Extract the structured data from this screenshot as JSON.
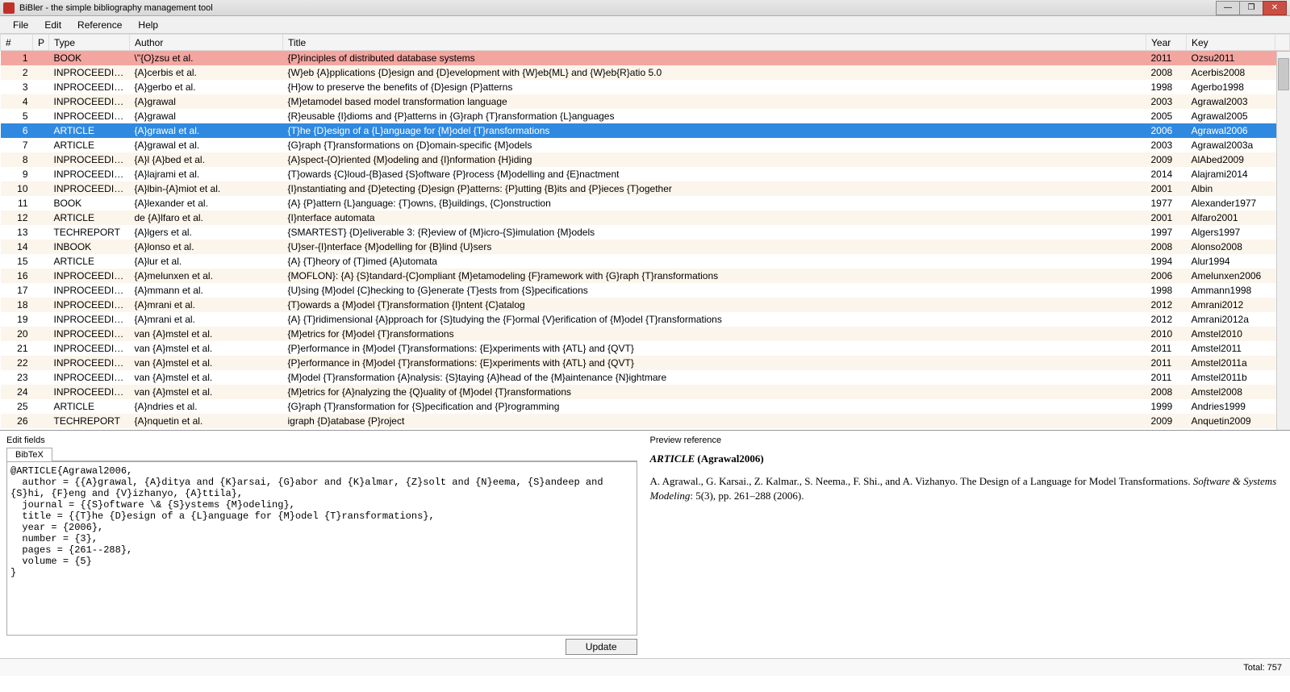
{
  "window": {
    "title": "BiBler - the simple bibliography management tool"
  },
  "menu": {
    "file": "File",
    "edit": "Edit",
    "reference": "Reference",
    "help": "Help"
  },
  "columns": {
    "num": "#",
    "p": "P",
    "type": "Type",
    "author": "Author",
    "title": "Title",
    "year": "Year",
    "key": "Key"
  },
  "rows": [
    {
      "n": "1",
      "type": "BOOK",
      "author": "\\\"{O}zsu et al.",
      "title": "{P}rinciples of distributed database systems",
      "year": "2011",
      "key": "Ozsu2011",
      "err": true
    },
    {
      "n": "2",
      "type": "INPROCEEDIN...",
      "author": "{A}cerbis et al.",
      "title": "{W}eb {A}pplications {D}esign and {D}evelopment with {W}eb{ML} and {W}eb{R}atio 5.0",
      "year": "2008",
      "key": "Acerbis2008"
    },
    {
      "n": "3",
      "type": "INPROCEEDIN...",
      "author": "{A}gerbo et al.",
      "title": "{H}ow to preserve the benefits of {D}esign {P}atterns",
      "year": "1998",
      "key": "Agerbo1998"
    },
    {
      "n": "4",
      "type": "INPROCEEDIN...",
      "author": "{A}grawal",
      "title": "{M}etamodel based model transformation language",
      "year": "2003",
      "key": "Agrawal2003"
    },
    {
      "n": "5",
      "type": "INPROCEEDIN...",
      "author": "{A}grawal",
      "title": "{R}eusable {I}dioms and {P}atterns in {G}raph {T}ransformation {L}anguages",
      "year": "2005",
      "key": "Agrawal2005"
    },
    {
      "n": "6",
      "type": "ARTICLE",
      "author": "{A}grawal et al.",
      "title": "{T}he {D}esign of a {L}anguage for {M}odel {T}ransformations",
      "year": "2006",
      "key": "Agrawal2006",
      "sel": true
    },
    {
      "n": "7",
      "type": "ARTICLE",
      "author": "{A}grawal et al.",
      "title": "{G}raph {T}ransformations on {D}omain-specific {M}odels",
      "year": "2003",
      "key": "Agrawal2003a"
    },
    {
      "n": "8",
      "type": "INPROCEEDIN...",
      "author": "{A}l {A}bed et al.",
      "title": "{A}spect-{O}riented {M}odeling and {I}nformation {H}iding",
      "year": "2009",
      "key": "AlAbed2009"
    },
    {
      "n": "9",
      "type": "INPROCEEDIN...",
      "author": "{A}lajrami et al.",
      "title": "{T}owards {C}loud-{B}ased {S}oftware {P}rocess {M}odelling and {E}nactment",
      "year": "2014",
      "key": "Alajrami2014"
    },
    {
      "n": "10",
      "type": "INPROCEEDIN...",
      "author": "{A}lbin-{A}miot et al.",
      "title": "{I}nstantiating and {D}etecting {D}esign {P}atterns: {P}utting {B}its and {P}ieces {T}ogether",
      "year": "2001",
      "key": "Albin"
    },
    {
      "n": "11",
      "type": "BOOK",
      "author": "{A}lexander et al.",
      "title": "{A} {P}attern {L}anguage: {T}owns, {B}uildings, {C}onstruction",
      "year": "1977",
      "key": "Alexander1977"
    },
    {
      "n": "12",
      "type": "ARTICLE",
      "author": "de {A}lfaro et al.",
      "title": "{I}nterface automata",
      "year": "2001",
      "key": "Alfaro2001"
    },
    {
      "n": "13",
      "type": "TECHREPORT",
      "author": "{A}lgers et al.",
      "title": "{SMARTEST} {D}eliverable 3: {R}eview of {M}icro-{S}imulation {M}odels",
      "year": "1997",
      "key": "Algers1997"
    },
    {
      "n": "14",
      "type": "INBOOK",
      "author": "{A}lonso et al.",
      "title": "{U}ser-{I}nterface {M}odelling for {B}lind {U}sers",
      "year": "2008",
      "key": "Alonso2008"
    },
    {
      "n": "15",
      "type": "ARTICLE",
      "author": "{A}lur et al.",
      "title": "{A} {T}heory of {T}imed {A}utomata",
      "year": "1994",
      "key": "Alur1994"
    },
    {
      "n": "16",
      "type": "INPROCEEDIN...",
      "author": "{A}melunxen et al.",
      "title": "{MOFLON}: {A} {S}tandard-{C}ompliant {M}etamodeling {F}ramework with {G}raph {T}ransformations",
      "year": "2006",
      "key": "Amelunxen2006"
    },
    {
      "n": "17",
      "type": "INPROCEEDIN...",
      "author": "{A}mmann et al.",
      "title": "{U}sing {M}odel {C}hecking to {G}enerate {T}ests from {S}pecifications",
      "year": "1998",
      "key": "Ammann1998"
    },
    {
      "n": "18",
      "type": "INPROCEEDIN...",
      "author": "{A}mrani et al.",
      "title": "{T}owards a {M}odel {T}ransformation {I}ntent {C}atalog",
      "year": "2012",
      "key": "Amrani2012"
    },
    {
      "n": "19",
      "type": "INPROCEEDIN...",
      "author": "{A}mrani et al.",
      "title": "{A} {T}ridimensional {A}pproach for {S}tudying the {F}ormal {V}erification of {M}odel {T}ransformations",
      "year": "2012",
      "key": "Amrani2012a"
    },
    {
      "n": "20",
      "type": "INPROCEEDIN...",
      "author": "van {A}mstel et al.",
      "title": "{M}etrics for {M}odel {T}ransformations",
      "year": "2010",
      "key": "Amstel2010"
    },
    {
      "n": "21",
      "type": "INPROCEEDIN...",
      "author": "van {A}mstel et al.",
      "title": "{P}erformance in {M}odel {T}ransformations: {E}xperiments with {ATL} and {QVT}",
      "year": "2011",
      "key": "Amstel2011"
    },
    {
      "n": "22",
      "type": "INPROCEEDIN...",
      "author": "van {A}mstel et al.",
      "title": "{P}erformance in {M}odel {T}ransformations: {E}xperiments with {ATL} and {QVT}",
      "year": "2011",
      "key": "Amstel2011a"
    },
    {
      "n": "23",
      "type": "INPROCEEDIN...",
      "author": "van {A}mstel et al.",
      "title": "{M}odel {T}ransformation {A}nalysis: {S}taying {A}head of the {M}aintenance {N}ightmare",
      "year": "2011",
      "key": "Amstel2011b"
    },
    {
      "n": "24",
      "type": "INPROCEEDIN...",
      "author": "van {A}mstel et al.",
      "title": "{M}etrics for {A}nalyzing the {Q}uality of {M}odel {T}ransformations",
      "year": "2008",
      "key": "Amstel2008"
    },
    {
      "n": "25",
      "type": "ARTICLE",
      "author": "{A}ndries et al.",
      "title": "{G}raph {T}ransformation for {S}pecification and {P}rogramming",
      "year": "1999",
      "key": "Andries1999"
    },
    {
      "n": "26",
      "type": "TECHREPORT",
      "author": "{A}nquetin et al.",
      "title": "igraph {D}atabase {P}roject",
      "year": "2009",
      "key": "Anquetin2009"
    }
  ],
  "edit": {
    "label": "Edit fields",
    "tab": "BibTeX",
    "content": "@ARTICLE{Agrawal2006,\n  author = {{A}grawal, {A}ditya and {K}arsai, {G}abor and {K}almar, {Z}solt and {N}eema, {S}andeep and {S}hi, {F}eng and {V}izhanyo, {A}ttila},\n  journal = {{S}oftware \\& {S}ystems {M}odeling},\n  title = {{T}he {D}esign of a {L}anguage for {M}odel {T}ransformations},\n  year = {2006},\n  number = {3},\n  pages = {261--288},\n  volume = {5}\n}",
    "update": "Update"
  },
  "preview": {
    "label": "Preview reference",
    "type": "ARTICLE",
    "key": "(Agrawal2006)",
    "authors": "A. Agrawal., G. Karsai., Z. Kalmar., S. Neema., F. Shi., and A. Vizhanyo. The Design of a Language for Model Transformations. ",
    "journal": "Software & Systems Modeling",
    "rest": ": 5(3), pp. 261–288 (2006)."
  },
  "status": {
    "total": "Total: 757"
  }
}
